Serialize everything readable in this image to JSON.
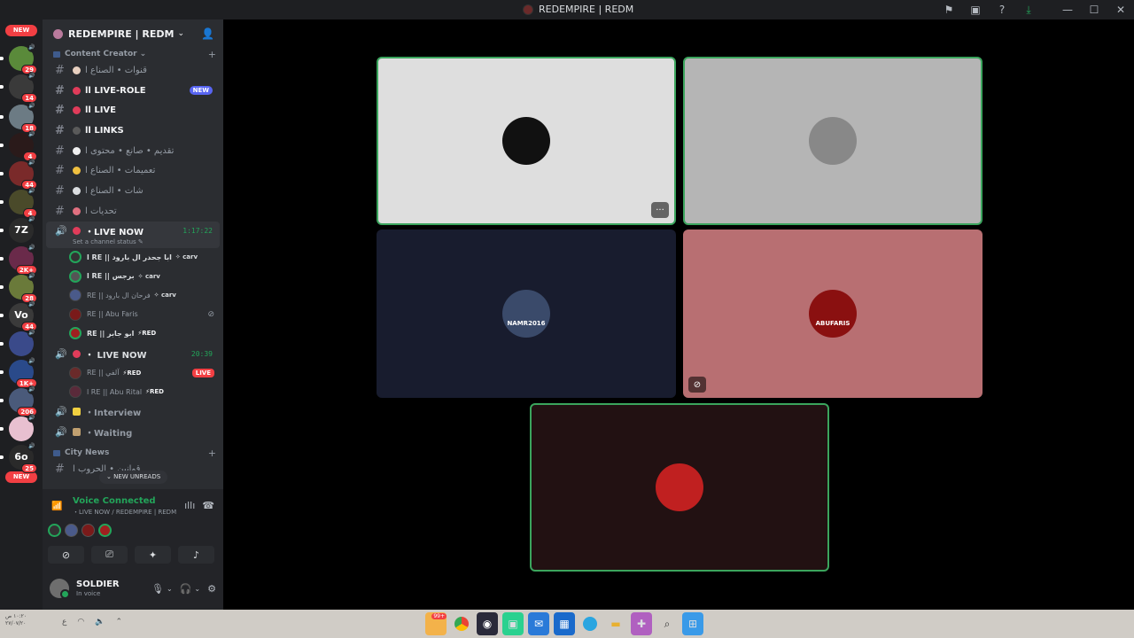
{
  "window": {
    "title": "REDEMPIRE | REDM",
    "controls": [
      "flag-icon",
      "inbox-icon",
      "help-icon",
      "download-icon",
      "minimize-icon",
      "maximize-icon",
      "close-icon"
    ]
  },
  "rail": {
    "new_top": "NEW",
    "new_bottom": "NEW",
    "servers": [
      {
        "badge": "29",
        "color": "#5a8a3a"
      },
      {
        "badge": "14",
        "color": "#3a3a3a"
      },
      {
        "badge": "18",
        "color": "#6c7b84"
      },
      {
        "badge": "4",
        "color": "#2a1a1a"
      },
      {
        "badge": "44",
        "color": "#7a2a2a"
      },
      {
        "badge": "4",
        "color": "#4a4a2a"
      },
      {
        "badge": "",
        "color": "#2b2b2b",
        "label": "7Z"
      },
      {
        "badge": "2K+",
        "color": "#6a2a4a"
      },
      {
        "badge": "28",
        "color": "#6a7a3a"
      },
      {
        "badge": "44",
        "color": "#3a3a3a",
        "label": "Vo"
      },
      {
        "badge": "",
        "color": "#3a4a8a"
      },
      {
        "badge": "1K+",
        "color": "#2a4a8a"
      },
      {
        "badge": "206",
        "color": "#4a5a7a"
      },
      {
        "badge": "",
        "color": "#e8c0d0"
      },
      {
        "badge": "25",
        "color": "#2a2a2a",
        "label": "6o"
      }
    ]
  },
  "sidebar": {
    "server_name": "REDEMPIRE | REDM",
    "category_1": "Content Creator",
    "channels": [
      {
        "label": "قنوات • الصناع ا",
        "bold": false,
        "emo": "#e8d0c0"
      },
      {
        "label": "اا LIVE-ROLE",
        "bold": true,
        "emo": "#e03c5a",
        "new": "NEW"
      },
      {
        "label": "اا LIVE",
        "bold": true,
        "emo": "#e03c5a"
      },
      {
        "label": "اا LINKS",
        "bold": true,
        "emo": "#5a5a5a"
      },
      {
        "label": "تقديم • صانع • محتوى ا",
        "bold": false,
        "emo": "#f0f0f0"
      },
      {
        "label": "تعميمات • الصناع ا",
        "bold": false,
        "emo": "#f0c040"
      },
      {
        "label": "شات • الصناع ا",
        "bold": false,
        "emo": "#dbdee1"
      },
      {
        "label": "تحديات ا",
        "bold": false,
        "emo": "#e07080"
      }
    ],
    "voice_1": {
      "name": "・LIVE NOW",
      "timer": "1:17:22",
      "status": "Set a channel status",
      "users": [
        {
          "name": "ا RE || ابا جحدر ال بارود",
          "tag": "✧ carv",
          "tagtype": "carv",
          "speaking": true,
          "muted": false,
          "avcolor": "#333",
          "bold": true
        },
        {
          "name": "ا RE || برجس",
          "tag": "✧ carv",
          "tagtype": "carv",
          "speaking": true,
          "muted": false,
          "avcolor": "#555",
          "bold": true
        },
        {
          "name": "RE || فرحان ال بارود",
          "tag": "✧ carv",
          "tagtype": "carv",
          "speaking": false,
          "muted": false,
          "avcolor": "#4a5a8a",
          "bold": false
        },
        {
          "name": "RE || Abu Faris",
          "tag": "",
          "tagtype": "",
          "speaking": false,
          "muted": true,
          "avcolor": "#7a1a1a",
          "bold": false
        },
        {
          "name": "RE || ابو جابر",
          "tag": "⚡RED",
          "tagtype": "red",
          "speaking": true,
          "muted": false,
          "avcolor": "#a02020",
          "bold": true
        }
      ]
    },
    "voice_2": {
      "name": "・ LIVE NOW",
      "timer": "20:39",
      "live": "LIVE",
      "users": [
        {
          "name": "RE || آلفي",
          "tag": "⚡RED",
          "avcolor": "#6a2a2a"
        },
        {
          "name": "ا RE || Abu Rital",
          "tag": "⚡RED",
          "avcolor": "#5a2a3a"
        }
      ]
    },
    "voice_3": [
      {
        "name": "・Interview",
        "emo": "#f0d040"
      },
      {
        "name": "・Waiting",
        "emo": "#c0a070"
      }
    ],
    "category_2": "City News",
    "last_channel": "قوانين • الحروب ا",
    "new_unreads": "NEW UNREADS"
  },
  "voice_panel": {
    "title": "Voice Connected",
    "subtitle": "・LIVE NOW / REDEMPIRE | REDM"
  },
  "user": {
    "name": "SOLDIER",
    "status": "In voice"
  },
  "tiles": [
    {
      "bg": "#dedede",
      "speaking": true,
      "av": "#111",
      "corner": "···"
    },
    {
      "bg": "#b5b5b5",
      "speaking": true,
      "av": "#888"
    },
    {
      "bg": "#181c2e",
      "speaking": false,
      "av": "#3a4a6a",
      "avtext": "NAMR2016"
    },
    {
      "bg": "#b86f72",
      "speaking": false,
      "av": "#8a1010",
      "avtext": "ABUFARIS",
      "corner": "✕"
    },
    {
      "bg": "#221112",
      "speaking": true,
      "av": "#c02020"
    }
  ],
  "taskbar": {
    "clock_time": "١٠:٢٠ ص",
    "clock_date": "٢٧/٠٧/٢٠",
    "badge": "99+"
  }
}
